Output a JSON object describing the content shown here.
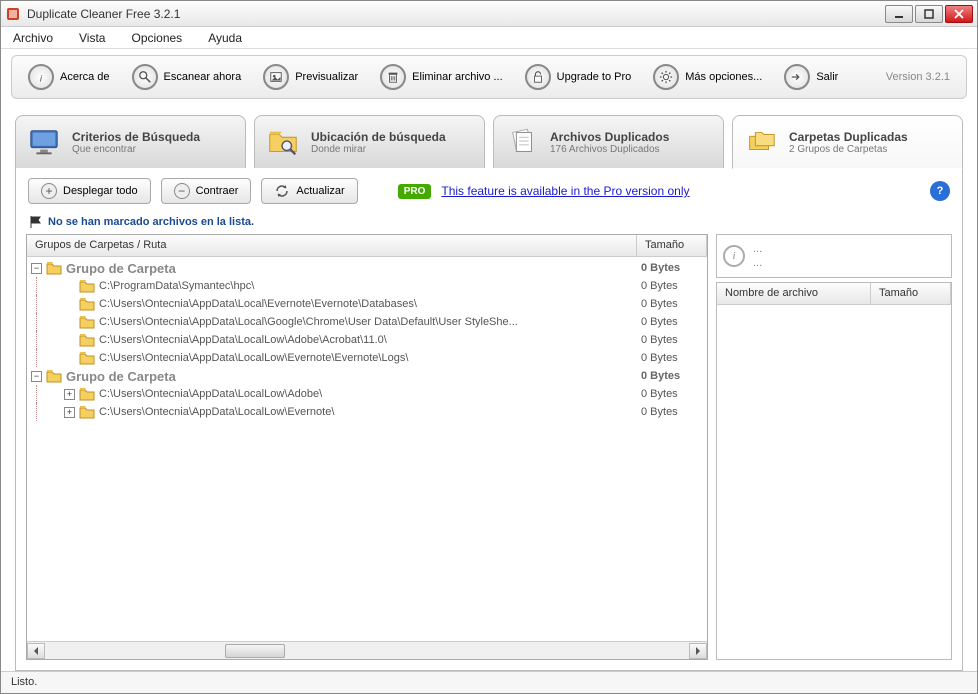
{
  "window": {
    "title": "Duplicate Cleaner Free 3.2.1"
  },
  "menu": {
    "archivo": "Archivo",
    "vista": "Vista",
    "opciones": "Opciones",
    "ayuda": "Ayuda"
  },
  "toolbar": {
    "about": "Acerca de",
    "scan": "Escanear ahora",
    "preview": "Previsualizar",
    "remove": "Eliminar archivo ...",
    "upgrade": "Upgrade to Pro",
    "more": "Más opciones...",
    "exit": "Salir",
    "version": "Version 3.2.1"
  },
  "tabs": {
    "criteria": {
      "title": "Criterios de Búsqueda",
      "sub": "Que encontrar"
    },
    "location": {
      "title": "Ubicación de búsqueda",
      "sub": "Donde mirar"
    },
    "dupfiles": {
      "title": "Archivos Duplicados",
      "sub": "176 Archivos Duplicados"
    },
    "dupfolders": {
      "title": "Carpetas Duplicadas",
      "sub": "2 Grupos de Carpetas"
    }
  },
  "actions": {
    "expand": "Desplegar todo",
    "collapse": "Contraer",
    "refresh": "Actualizar",
    "pro_badge": "PRO",
    "pro_link": "This feature is available in the Pro version only"
  },
  "note": "No se han marcado archivos en la lista.",
  "cols": {
    "path": "Grupos de Carpetas / Ruta",
    "size": "Tamaño"
  },
  "groups": [
    {
      "name": "Grupo de Carpeta",
      "size": "0 Bytes",
      "items": [
        {
          "path": "C:\\ProgramData\\Symantec\\hpc\\",
          "size": "0 Bytes",
          "expandable": false
        },
        {
          "path": "C:\\Users\\Ontecnia\\AppData\\Local\\Evernote\\Evernote\\Databases\\",
          "size": "0 Bytes",
          "expandable": false
        },
        {
          "path": "C:\\Users\\Ontecnia\\AppData\\Local\\Google\\Chrome\\User Data\\Default\\User StyleShe...",
          "size": "0 Bytes",
          "expandable": false
        },
        {
          "path": "C:\\Users\\Ontecnia\\AppData\\LocalLow\\Adobe\\Acrobat\\11.0\\",
          "size": "0 Bytes",
          "expandable": false
        },
        {
          "path": "C:\\Users\\Ontecnia\\AppData\\LocalLow\\Evernote\\Evernote\\Logs\\",
          "size": "0 Bytes",
          "expandable": false
        }
      ]
    },
    {
      "name": "Grupo de Carpeta",
      "size": "0 Bytes",
      "items": [
        {
          "path": "C:\\Users\\Ontecnia\\AppData\\LocalLow\\Adobe\\",
          "size": "0 Bytes",
          "expandable": true
        },
        {
          "path": "C:\\Users\\Ontecnia\\AppData\\LocalLow\\Evernote\\",
          "size": "0 Bytes",
          "expandable": true
        }
      ]
    }
  ],
  "right": {
    "info_dash": "...",
    "col_name": "Nombre de archivo",
    "col_size": "Tamaño"
  },
  "statusbar": "Listo."
}
